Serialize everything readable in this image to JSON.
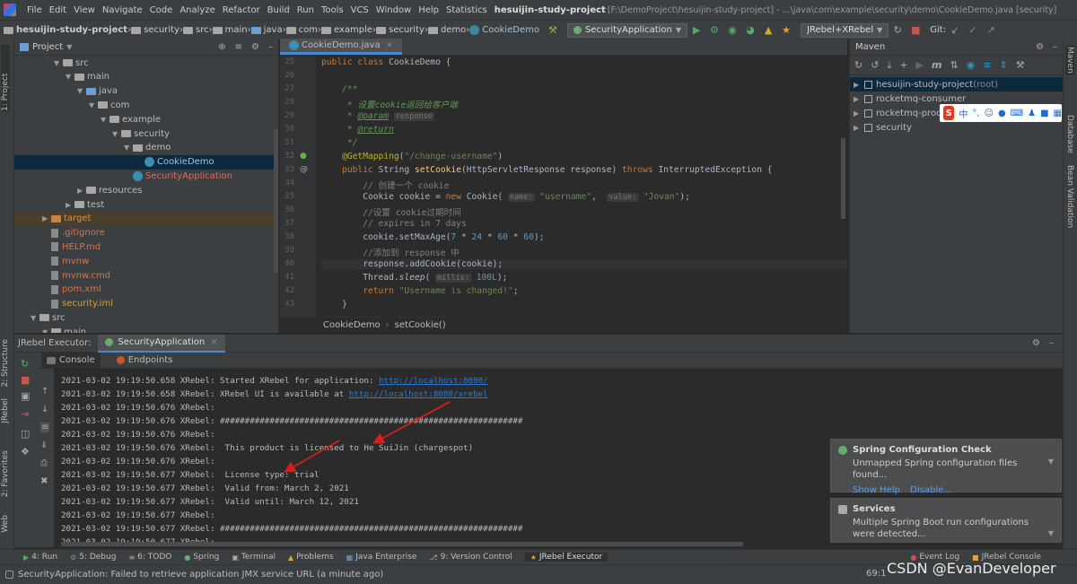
{
  "menubar": {
    "items": [
      "File",
      "Edit",
      "View",
      "Navigate",
      "Code",
      "Analyze",
      "Refactor",
      "Build",
      "Run",
      "Tools",
      "VCS",
      "Window",
      "Help",
      "Statistics"
    ],
    "project_title": "hesuijin-study-project",
    "project_path": "[F:\\DemoProject\\hesuijin-study-project] - ...\\java\\com\\example\\security\\demo\\CookieDemo.java [security]"
  },
  "navbar": {
    "crumbs": [
      "hesuijin-study-project",
      "security",
      "src",
      "main",
      "java",
      "com",
      "example",
      "security",
      "demo",
      "CookieDemo"
    ],
    "run_config": "SecurityApplication",
    "jrebel_mode": "JRebel+XRebel",
    "git_label": "Git:"
  },
  "left_strip": {
    "project_tab": "1: Project",
    "structure_tab": "2: Structure",
    "jrebel_tab": "JRebel",
    "favorites_tab": "2: Favorites",
    "web_tab": "Web"
  },
  "project_panel": {
    "title": "Project",
    "tree": [
      {
        "label": "src",
        "depth": 4,
        "kind": "folder",
        "arrow": "down"
      },
      {
        "label": "main",
        "depth": 5,
        "kind": "folder",
        "arrow": "down"
      },
      {
        "label": "java",
        "depth": 6,
        "kind": "folder-blue",
        "arrow": "down"
      },
      {
        "label": "com",
        "depth": 7,
        "kind": "folder",
        "arrow": "down"
      },
      {
        "label": "example",
        "depth": 8,
        "kind": "folder",
        "arrow": "down"
      },
      {
        "label": "security",
        "depth": 9,
        "kind": "folder",
        "arrow": "down"
      },
      {
        "label": "demo",
        "depth": 10,
        "kind": "folder",
        "arrow": "down"
      },
      {
        "label": "CookieDemo",
        "depth": 11,
        "kind": "class",
        "arrow": ""
      },
      {
        "label": "SecurityApplication",
        "depth": 10,
        "kind": "spring",
        "arrow": ""
      },
      {
        "label": "resources",
        "depth": 6,
        "kind": "folder",
        "arrow": "right"
      },
      {
        "label": "test",
        "depth": 5,
        "kind": "folder",
        "arrow": "right"
      },
      {
        "label": "target",
        "depth": 3,
        "kind": "folder-orange",
        "arrow": "right"
      },
      {
        "label": ".gitignore",
        "depth": 3,
        "kind": "file",
        "arrow": ""
      },
      {
        "label": "HELP.md",
        "depth": 3,
        "kind": "file",
        "arrow": ""
      },
      {
        "label": "mvnw",
        "depth": 3,
        "kind": "file",
        "arrow": ""
      },
      {
        "label": "mvnw.cmd",
        "depth": 3,
        "kind": "file",
        "arrow": ""
      },
      {
        "label": "pom.xml",
        "depth": 3,
        "kind": "file",
        "arrow": ""
      },
      {
        "label": "security.iml",
        "depth": 3,
        "kind": "file",
        "arrow": ""
      },
      {
        "label": "src",
        "depth": 2,
        "kind": "folder",
        "arrow": "down"
      },
      {
        "label": "main",
        "depth": 3,
        "kind": "folder",
        "arrow": "down"
      }
    ]
  },
  "editor": {
    "tab": "CookieDemo.java",
    "lines": [
      {
        "n": "25",
        "html": "<span class='kw'>public class</span> CookieDemo {"
      },
      {
        "n": "26",
        "html": ""
      },
      {
        "n": "27",
        "html": "    <span class='jd'>/**</span>"
      },
      {
        "n": "28",
        "html": "    <span class='jd'> * 设置cookie返回给客户端</span>"
      },
      {
        "n": "29",
        "html": "    <span class='jd'> * </span><span class='jd' style='text-decoration:underline'>@param</span> <span class='hint'>response</span>"
      },
      {
        "n": "30",
        "html": "    <span class='jd'> * </span><span class='jd' style='text-decoration:underline'>@return</span>"
      },
      {
        "n": "31",
        "html": "    <span class='jd'> */</span>"
      },
      {
        "n": "32",
        "html": "    <span class='ann'>@GetMapping</span>(<span class='str'>\"/change-username\"</span>)"
      },
      {
        "n": "33",
        "html": "    <span class='kw'>public</span> String <span class='fn'>setCookie</span>(HttpServletResponse response) <span class='kw'>throws</span> InterruptedException {"
      },
      {
        "n": "34",
        "html": "        <span class='cm'>// 创建一个 cookie</span>"
      },
      {
        "n": "35",
        "html": "        Cookie cookie = <span class='kw'>new</span> Cookie( <span class='hint'>name:</span> <span class='str'>\"username\"</span>,  <span class='hint'>value:</span> <span class='str'>\"Jovan\"</span>);"
      },
      {
        "n": "36",
        "html": "        <span class='cm'>//设置 cookie过期时间</span>"
      },
      {
        "n": "37",
        "html": "        <span class='cm'>// expires in 7 days</span>"
      },
      {
        "n": "38",
        "html": "        cookie.setMaxAge(<span class='num'>7</span> * <span class='num'>24</span> * <span class='num'>60</span> * <span class='num'>60</span>);"
      },
      {
        "n": "39",
        "html": "        <span class='cm'>//添加到 response 中</span>"
      },
      {
        "n": "40",
        "html": "        response.addCookie(cookie);"
      },
      {
        "n": "41",
        "html": "        Thread.<span style='font-style:italic'>sleep</span>( <span class='hint'>millis:</span> <span class='num'>100L</span>);"
      },
      {
        "n": "42",
        "html": "        <span class='kw'>return</span> <span class='str'>\"Username is changed!\"</span>;"
      },
      {
        "n": "43",
        "html": "    }"
      }
    ],
    "breadcrumb": [
      "CookieDemo",
      "setCookie()"
    ]
  },
  "maven": {
    "title": "Maven",
    "items": [
      {
        "label": "hesuijin-study-project",
        "suffix": "(root)"
      },
      {
        "label": "rocketmq-consumer",
        "suffix": ""
      },
      {
        "label": "rocketmq-produ",
        "suffix": ""
      },
      {
        "label": "security",
        "suffix": ""
      }
    ],
    "ime_text": "中"
  },
  "right_strip": {
    "maven_tab": "Maven",
    "db_tab": "Database",
    "bean_tab": "Bean Validation"
  },
  "run_panel": {
    "executor_label": "JRebel Executor:",
    "tab": "SecurityApplication",
    "sub_tabs": [
      "Console",
      "Endpoints"
    ],
    "log": [
      {
        "t": "2021-03-02 19:19:50.658 XRebel: Started XRebel for application: ",
        "link": "http://localhost:8080/"
      },
      {
        "t": "2021-03-02 19:19:50.658 XRebel: XRebel UI is available at ",
        "link": "http://localhost:8080/xrebel"
      },
      {
        "t": "2021-03-02 19:19:50.676 XRebel:",
        "link": ""
      },
      {
        "t": "2021-03-02 19:19:50.676 XRebel: #############################################################",
        "link": ""
      },
      {
        "t": "2021-03-02 19:19:50.676 XRebel:",
        "link": ""
      },
      {
        "t": "2021-03-02 19:19:50.676 XRebel:  This product is licensed to He SuiJin (chargespot)",
        "link": ""
      },
      {
        "t": "2021-03-02 19:19:50.676 XRebel:",
        "link": ""
      },
      {
        "t": "2021-03-02 19:19:50.677 XRebel:  License type: trial",
        "link": ""
      },
      {
        "t": "2021-03-02 19:19:50.677 XRebel:  Valid from: March 2, 2021",
        "link": ""
      },
      {
        "t": "2021-03-02 19:19:50.677 XRebel:  Valid until: March 12, 2021",
        "link": ""
      },
      {
        "t": "2021-03-02 19:19:50.677 XRebel:",
        "link": ""
      },
      {
        "t": "2021-03-02 19:19:50.677 XRebel: #############################################################",
        "link": ""
      },
      {
        "t": "2021-03-02 19:19:50.677 XRebel:",
        "link": ""
      }
    ]
  },
  "notifications": [
    {
      "title": "Spring Configuration Check",
      "text": "Unmapped Spring configuration files found...",
      "links": [
        "Show Help",
        "Disable..."
      ]
    },
    {
      "title": "Services",
      "text": "Multiple Spring Boot run configurations were detected...",
      "links": []
    }
  ],
  "bottom_tools": [
    {
      "label": "4: Run",
      "ul": "4"
    },
    {
      "label": "5: Debug",
      "ul": "5"
    },
    {
      "label": "6: TODO",
      "ul": "6"
    },
    {
      "label": "Spring",
      "ul": ""
    },
    {
      "label": "Terminal",
      "ul": ""
    },
    {
      "label": "Problems",
      "ul": ""
    },
    {
      "label": "Java Enterprise",
      "ul": ""
    },
    {
      "label": "9: Version Control",
      "ul": "9"
    },
    {
      "label": "JRebel Executor",
      "ul": ""
    },
    {
      "label": "Event Log",
      "ul": ""
    },
    {
      "label": "JRebel Console",
      "ul": ""
    }
  ],
  "status": {
    "message": "SecurityApplication: Failed to retrieve application JMX service URL (a minute ago)",
    "position": "69:1",
    "watermark": "CSDN @EvanDeveloper"
  },
  "colors": {
    "accent": "#4a88c7",
    "link": "#287bde",
    "arrow_red": "#e01b1b"
  }
}
